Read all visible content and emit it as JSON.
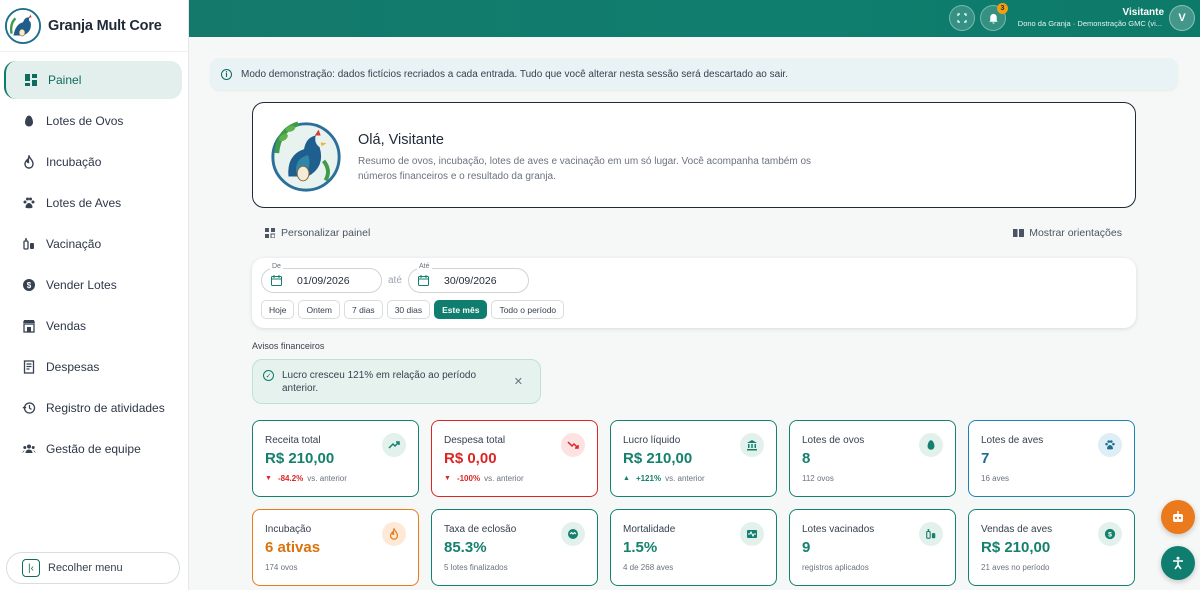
{
  "brand": {
    "name": "Granja Mult Core"
  },
  "sidebar": {
    "items": [
      {
        "label": "Painel",
        "icon": "dashboard-icon"
      },
      {
        "label": "Lotes de Ovos",
        "icon": "egg-icon"
      },
      {
        "label": "Incubação",
        "icon": "flame-icon"
      },
      {
        "label": "Lotes de Aves",
        "icon": "paw-icon"
      },
      {
        "label": "Vacinação",
        "icon": "vaccine-icon"
      },
      {
        "label": "Vender Lotes",
        "icon": "dollar-icon"
      },
      {
        "label": "Vendas",
        "icon": "store-icon"
      },
      {
        "label": "Despesas",
        "icon": "receipt-icon"
      },
      {
        "label": "Registro de atividades",
        "icon": "history-icon"
      },
      {
        "label": "Gestão de equipe",
        "icon": "team-icon"
      }
    ],
    "collapse_label": "Recolher menu"
  },
  "topbar": {
    "notifications_count": "3",
    "user_name": "Visitante",
    "user_role": "Dono da Granja · Demonstração GMC (vi...",
    "avatar_initial": "V"
  },
  "notice": {
    "text": "Modo demonstração: dados fictícios recriados a cada entrada. Tudo que você alterar nesta sessão será descartado ao sair."
  },
  "hero": {
    "title": "Olá, Visitante",
    "description": "Resumo de ovos, incubação, lotes de aves e vacinação em um só lugar. Você acompanha também os números financeiros e o resultado da granja."
  },
  "tools": {
    "customize": "Personalizar painel",
    "guides": "Mostrar orientações"
  },
  "filter": {
    "from_label": "De",
    "from_value": "01/09/2026",
    "separator": "até",
    "to_label": "Até",
    "to_value": "30/09/2026",
    "chips": [
      "Hoje",
      "Ontem",
      "7 dias",
      "30 dias",
      "Este mês",
      "Todo o período"
    ],
    "active_chip": "Este mês"
  },
  "alerts": {
    "section_label": "Avisos financeiros",
    "message": "Lucro cresceu 121% em relação ao período anterior."
  },
  "kpis": [
    {
      "title": "Receita total",
      "value": "R$ 210,00",
      "delta": "-84.2%",
      "delta_dir": "down",
      "compare": "vs. anterior",
      "icon": "trending-up-icon",
      "color": "green"
    },
    {
      "title": "Despesa total",
      "value": "R$ 0,00",
      "delta": "-100%",
      "delta_dir": "down",
      "compare": "vs. anterior",
      "icon": "trending-down-icon",
      "color": "red"
    },
    {
      "title": "Lucro líquido",
      "value": "R$ 210,00",
      "delta": "+121%",
      "delta_dir": "up",
      "compare": "vs. anterior",
      "icon": "bank-icon",
      "color": "green"
    },
    {
      "title": "Lotes de ovos",
      "value": "8",
      "note": "112 ovos",
      "icon": "egg-icon",
      "color": "green"
    },
    {
      "title": "Lotes de aves",
      "value": "7",
      "note": "16 aves",
      "icon": "paw-icon",
      "color": "blue"
    },
    {
      "title": "Incubação",
      "value": "6 ativas",
      "note": "174 ovos",
      "icon": "flame-icon",
      "color": "orange"
    },
    {
      "title": "Taxa de eclosão",
      "value": "85.3%",
      "note": "5 lotes finalizados",
      "icon": "hatch-icon",
      "color": "green"
    },
    {
      "title": "Mortalidade",
      "value": "1.5%",
      "note": "4 de 268 aves",
      "icon": "monitor-heart-icon",
      "color": "green"
    },
    {
      "title": "Lotes vacinados",
      "value": "9",
      "note": "registros aplicados",
      "icon": "vaccine-icon",
      "color": "green"
    },
    {
      "title": "Vendas de aves",
      "value": "R$ 210,00",
      "note": "21 aves no período",
      "icon": "dollar-icon",
      "color": "green"
    }
  ]
}
